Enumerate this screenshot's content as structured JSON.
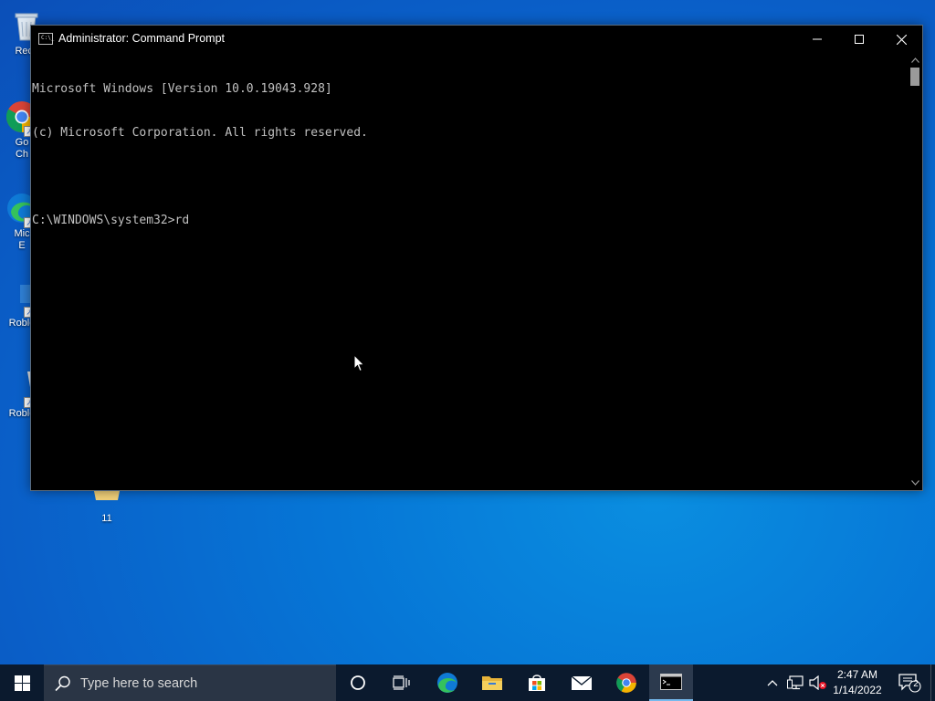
{
  "window": {
    "title": "Administrator: Command Prompt",
    "icon_label": "C:\\_"
  },
  "console": {
    "lines": [
      "Microsoft Windows [Version 10.0.19043.928]",
      "(c) Microsoft Corporation. All rights reserved.",
      "",
      "C:\\WINDOWS\\system32>rd"
    ]
  },
  "desktop_icons": [
    {
      "label_1": "Recy",
      "label_2": "",
      "icon": "recycle-bin-icon"
    },
    {
      "label_1": "Go",
      "label_2": "Ch",
      "icon": "chrome-icon"
    },
    {
      "label_1": "Mic",
      "label_2": "E",
      "icon": "edge-icon"
    },
    {
      "label_1": "Roblo",
      "label_2": "",
      "icon": "roblox-icon"
    },
    {
      "label_1": "Roblo",
      "label_2": "",
      "icon": "roblox-studio-icon"
    },
    {
      "label_1": "11",
      "label_2": "",
      "icon": "folder-icon"
    }
  ],
  "taskbar": {
    "search_placeholder": "Type here to search",
    "apps": [
      "edge",
      "file-explorer",
      "microsoft-store",
      "mail",
      "chrome",
      "command-prompt"
    ],
    "active_app": "command-prompt",
    "clock_time": "2:47 AM",
    "clock_date": "1/14/2022",
    "notification_count": "2"
  },
  "colors": {
    "desktop": "#0a6fd8",
    "taskbar": "#0b1a2e",
    "console_text": "#c0c0c0",
    "accent": "#76b9ed"
  }
}
